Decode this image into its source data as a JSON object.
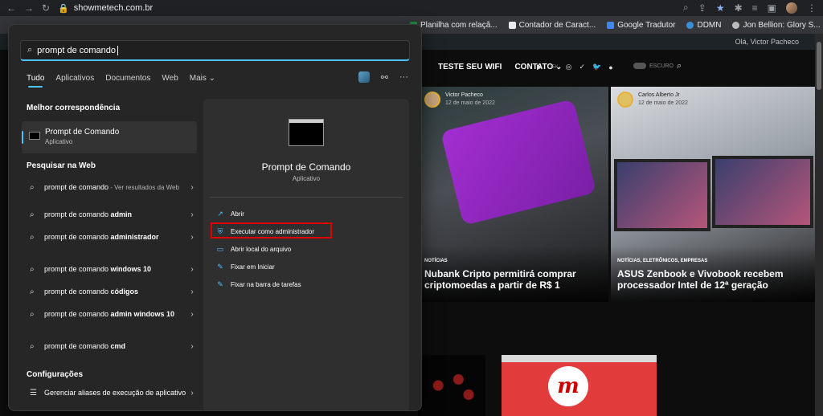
{
  "browser": {
    "url": "showmetech.com.br",
    "bookmarks": [
      {
        "label": "Planilha com relaçã...",
        "color": "#1e8e3e"
      },
      {
        "label": "Contador de Caract...",
        "color": "#e8eaed"
      },
      {
        "label": "Google Tradutor",
        "color": "#4285f4"
      },
      {
        "label": "DDMN",
        "color": "#3b8fd6"
      },
      {
        "label": "Jon Bellion: Glory S...",
        "color": "#bbbbbb"
      }
    ]
  },
  "site": {
    "wp_user": "Olá, Victor Pacheco",
    "nav": [
      "TESTE SEU WIFI",
      "CONTATO ⌄"
    ],
    "icons": [
      "▶",
      "25K",
      "◎",
      "✓",
      "🐦",
      "●"
    ],
    "toggle_label": "ESCURO",
    "cards": [
      {
        "author": "Victor Pacheco",
        "date": "12 de maio de 2022",
        "tag": "NOTÍCIAS",
        "headline": "Nubank Cripto permitirá comprar criptomoedas a partir de R$ 1"
      },
      {
        "author": "Carlos Alberto Jr",
        "date": "12 de maio de 2022",
        "tag": "NOTÍCIAS, ELETRÔNICOS, EMPRESAS",
        "headline": "ASUS Zenbook e Vivobook recebem processador Intel de 12ª geração"
      }
    ]
  },
  "start": {
    "search_value": "prompt de comando",
    "tabs": [
      "Tudo",
      "Aplicativos",
      "Documentos",
      "Web",
      "Mais ⌄"
    ],
    "best_match_title": "Melhor correspondência",
    "best_match": {
      "name": "Prompt de Comando",
      "type": "Aplicativo"
    },
    "web_title": "Pesquisar na Web",
    "web_items": [
      {
        "prefix": "prompt de comando",
        "bold": "",
        "suffix": " - Ver resultados da Web"
      },
      {
        "prefix": "prompt de comando ",
        "bold": "admin",
        "suffix": ""
      },
      {
        "prefix": "prompt de comando ",
        "bold": "administrador",
        "suffix": ""
      },
      {
        "prefix": "prompt de comando ",
        "bold": "windows 10",
        "suffix": ""
      },
      {
        "prefix": "prompt de comando ",
        "bold": "códigos",
        "suffix": ""
      },
      {
        "prefix": "prompt de comando ",
        "bold": "admin windows 10",
        "suffix": ""
      },
      {
        "prefix": "prompt de comando ",
        "bold": "cmd",
        "suffix": ""
      }
    ],
    "settings_title": "Configurações",
    "settings_item": "Gerenciar aliases de execução de aplicativo",
    "preview": {
      "title": "Prompt de Comando",
      "subtitle": "Aplicativo",
      "actions": [
        "Abrir",
        "Executar como administrador",
        "Abrir local do arquivo",
        "Fixar em Iniciar",
        "Fixar na barra de tarefas"
      ]
    },
    "accent_color": "#4cc2ff",
    "highlight_color": "#e00000"
  }
}
